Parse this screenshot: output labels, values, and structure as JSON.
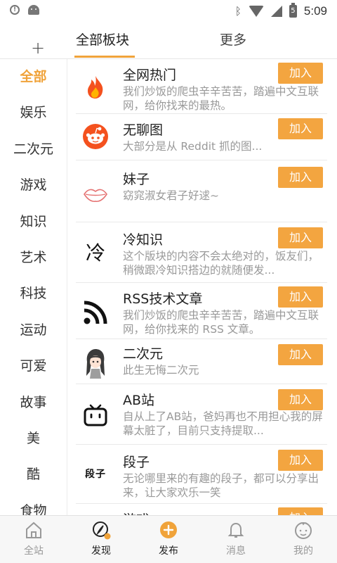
{
  "status_bar": {
    "time": "5:09",
    "battery_level": "5"
  },
  "header": {
    "add_label": "+",
    "tabs": [
      {
        "label": "全部板块",
        "active": true
      },
      {
        "label": "更多",
        "active": false
      }
    ]
  },
  "sidebar": {
    "categories": [
      "全部",
      "娱乐",
      "二次元",
      "游戏",
      "知识",
      "艺术",
      "科技",
      "运动",
      "可爱",
      "故事",
      "美",
      "酷",
      "食物"
    ],
    "active": "全部"
  },
  "boards": [
    {
      "title": "全网热门",
      "desc": "我们炒饭的爬虫辛辛苦苦，踏遍中文互联网，给你找来的最热。",
      "button": "加入",
      "icon": "flame-icon"
    },
    {
      "title": "无聊图",
      "desc": "大部分是从 Reddit 抓的图...",
      "button": "加入",
      "icon": "reddit-icon"
    },
    {
      "title": "妹子",
      "desc": "窈窕淑女君子好逑~",
      "button": "加入",
      "icon": "lips-icon"
    },
    {
      "title": "冷知识",
      "desc": "这个版块的内容不会太绝对的，饭友们，稍微跟冷知识搭边的就随便发...",
      "button": "加入",
      "icon": "calligraphy-icon",
      "icon_text": "冷"
    },
    {
      "title": "RSS技术文章",
      "desc": "我们炒饭的爬虫辛辛苦苦，踏遍中文互联网，给你找来的 RSS 文章。",
      "button": "加入",
      "icon": "rss-icon"
    },
    {
      "title": "二次元",
      "desc": "此生无悔二次元",
      "button": "加入",
      "icon": "anime-girl-icon"
    },
    {
      "title": "AB站",
      "desc": "自从上了AB站，爸妈再也不用担心我的屏幕太脏了，目前只支持提取...",
      "button": "加入",
      "icon": "bilibili-tv-icon"
    },
    {
      "title": "段子",
      "desc": "无论哪里来的有趣的段子，都可以分享出来，让大家欢乐一笑",
      "button": "加入",
      "icon": "duanzi-icon",
      "icon_text": "段子"
    },
    {
      "title": "游戏",
      "desc": "",
      "button": "加入",
      "icon": "game-icon"
    }
  ],
  "bottom_nav": [
    {
      "label": "全站",
      "icon": "home-icon",
      "active": false
    },
    {
      "label": "发现",
      "icon": "discover-icon",
      "active": true
    },
    {
      "label": "发布",
      "icon": "publish-plus-icon",
      "active": false
    },
    {
      "label": "消息",
      "icon": "bell-icon",
      "active": false
    },
    {
      "label": "我的",
      "icon": "profile-face-icon",
      "active": false
    }
  ],
  "colors": {
    "accent": "#f0a33a",
    "button": "#f3a540",
    "reddit": "#f4511e"
  }
}
